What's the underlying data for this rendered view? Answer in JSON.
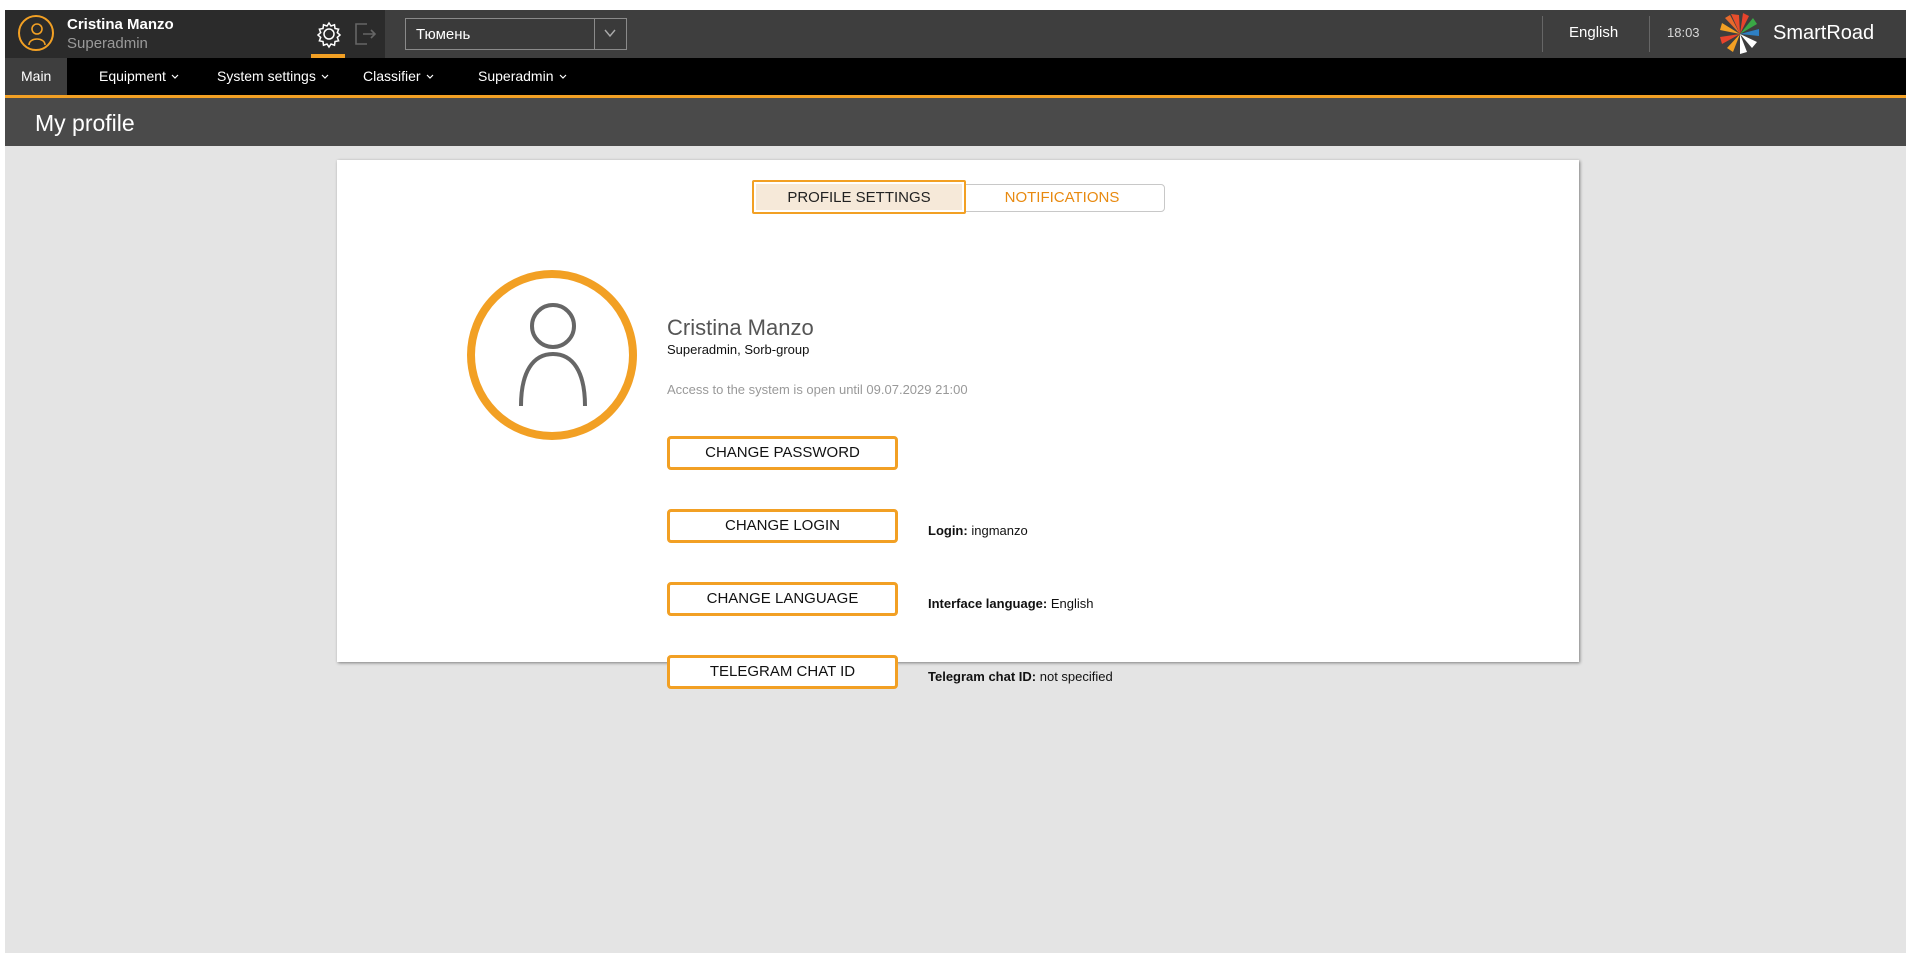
{
  "header": {
    "user_name": "Cristina Manzo",
    "user_role": "Superadmin",
    "city": "Тюмень",
    "language": "English",
    "time": "18:03",
    "brand": "SmartRoad"
  },
  "nav": {
    "items": [
      {
        "label": "Main",
        "active": true
      },
      {
        "label": "Equipment"
      },
      {
        "label": "System settings"
      },
      {
        "label": "Classifier"
      },
      {
        "label": "Superadmin"
      }
    ]
  },
  "page": {
    "title": "My profile"
  },
  "tabs": {
    "profile": "PROFILE SETTINGS",
    "notifications": "NOTIFICATIONS"
  },
  "profile": {
    "name": "Cristina Manzo",
    "org": "Superadmin, Sorb-group",
    "access": "Access to the system is open until 09.07.2029 21:00",
    "buttons": {
      "change_password": "CHANGE PASSWORD",
      "change_login": "CHANGE LOGIN",
      "change_language": "CHANGE LANGUAGE",
      "telegram": "TELEGRAM CHAT ID"
    },
    "login_label": "Login:",
    "login_value": "ingmanzo",
    "language_label": "Interface language:",
    "language_value": "English",
    "telegram_label": "Telegram chat ID:",
    "telegram_value": "not specified"
  },
  "colors": {
    "accent": "#f2a024",
    "topbar": "#3e3e3e",
    "navbar": "#000000"
  }
}
